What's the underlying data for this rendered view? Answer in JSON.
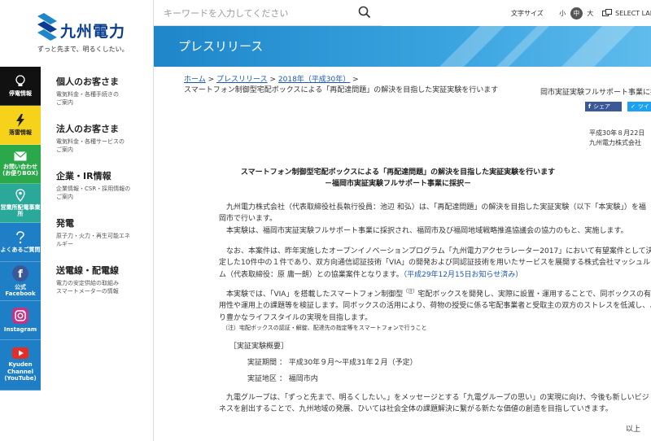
{
  "brand": {
    "name": "九州電力",
    "tagline": "ずっと先まで、明るくしたい。"
  },
  "header": {
    "search_placeholder": "キーワードを入力してください",
    "fontsize_label": "文字サイズ",
    "fontsize_options": [
      "小",
      "中",
      "大"
    ],
    "fontsize_selected": "中",
    "language_label": "SELECT LANG"
  },
  "banner": {
    "title": "プレスリリース"
  },
  "icon_nav": [
    {
      "label": "停電情報",
      "icon": "lightbulb-icon"
    },
    {
      "label": "落雷情報",
      "icon": "lightning-icon"
    },
    {
      "label": "お問い合わせ(お便りBOX)",
      "icon": "mail-icon"
    },
    {
      "label": "営業所配電事業所",
      "icon": "location-icon"
    },
    {
      "label": "よくあるご質問",
      "icon": "question-icon"
    },
    {
      "label": "公式Facebook",
      "icon": "facebook-icon"
    },
    {
      "label": "Instagram",
      "icon": "instagram-icon"
    },
    {
      "label": "Kyuden Channel (YouTube)",
      "icon": "youtube-icon"
    }
  ],
  "text_nav": [
    {
      "title": "個人のお客さま",
      "sub1": "電気料金・各種手続きの",
      "sub2": "ご案内"
    },
    {
      "title": "法人のお客さま",
      "sub1": "電気料金・各種サービスの",
      "sub2": "ご案内"
    },
    {
      "title": "企業・IR情報",
      "sub1": "企業情報・CSR・採用情報の",
      "sub2": "ご案内"
    },
    {
      "title": "発電",
      "sub1": "原子力・火力・再生可能エネ",
      "sub2": "ルギー"
    },
    {
      "title": "送電線・配電線",
      "sub1": "電力の安定供給の取組み",
      "sub2": "スマートメーターの情報"
    }
  ],
  "breadcrumb": {
    "home": "ホーム",
    "press": "プレスリリース",
    "year": "2018年（平成30年）",
    "sep": ">",
    "current1": "スマートフォン制御型宅配ボックスによる「再配達問題」の解決を目指した実証実験を行います",
    "current2": "岡市実証実験フルサポート事業に採"
  },
  "share": {
    "facebook": "シェア",
    "twitter": "ツイ"
  },
  "date": {
    "date": "平成30年８月22日",
    "company": "九州電力株式会社"
  },
  "article": {
    "title": "スマートフォン制御型宅配ボックスによる「再配達問題」の解決を目指した実証実験を行います",
    "subtitle": "－福岡市実証実験フルサポート事業に採択－",
    "p1a": "九州電力株式会社（代表取締役社長執行役員：池辺 和弘）は、「再配達問題」の解決を目指した実証実験（以下「本実験」）を福",
    "p1b": "岡市で行います。",
    "p2": "本実験は、福岡市実証実験フルサポート事業に採択され、福岡市及び福岡地域戦略推進協議会の協力のもと、実施します。",
    "p3a": "なお、本案件は、昨年実施したオープンイノベーションプログラム「九州電力アクセラレーター2017」において有望案件として決",
    "p3b": "定した10件中の１件であり、双方向通信認証技術「VIA」の開発および同認証技術を用いたサービスを展開する株式会社マッシュルー",
    "p3c": "ム（代表取締役：原 庸一朗）との協業案件となります。",
    "p3link": "（平成29年12月15日お知らせ済み）",
    "p4a": "本実験では、「VIA」を搭載したスマートフォン制御型",
    "p4note": "（注）",
    "p4b": "宅配ボックスを開発し、実際に設置・運用することで、同ボックスの有",
    "p4c": "用性や運用上の課題等を検証します。同ボックスの活用により、荷物の授受に係る宅配事業者と受取主の双方のストレスを低減し、よ",
    "p4d": "り豊かなライフスタイルの実現を目指します。",
    "footnote": "（注）宅配ボックスの認証・解錠、配達先の指定等をスマートフォンで行うこと",
    "overview_heading": "［実証実験概要］",
    "period": "実証期間 ： 平成30年９月～平成31年２月（予定）",
    "area": "実証地区 ： 福岡市内",
    "p5a": "九電グループは、「ずっと先まで、明るくしたい。」をメッセージとする「九電グループの思い」の実現に向け、今後も新しいビジ",
    "p5b": "ネスを創出することで、九州地域の発展、ひいては社会全体の課題解決に繋がる新たな価値の創造を目指していきます。",
    "end": "以上"
  }
}
